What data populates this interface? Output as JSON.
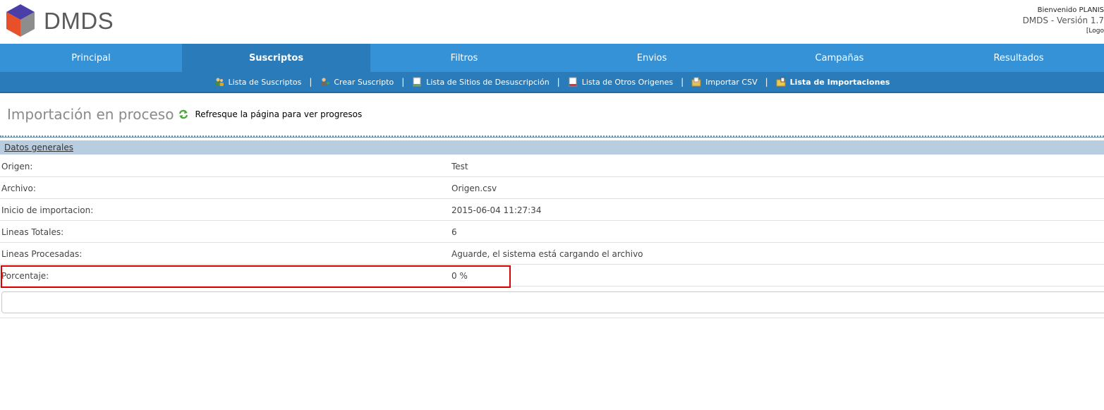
{
  "header": {
    "brand": "DMDS",
    "welcome": "Bienvenido PLANIS",
    "version": "DMDS - Versión 1.7",
    "logout": "[Logo"
  },
  "mainnav": {
    "items": [
      {
        "label": "Principal"
      },
      {
        "label": "Suscriptos",
        "active": true
      },
      {
        "label": "Filtros"
      },
      {
        "label": "Envios"
      },
      {
        "label": "Campañas"
      },
      {
        "label": "Resultados"
      }
    ]
  },
  "subnav": {
    "items": [
      {
        "label": "Lista de Suscriptos",
        "icon": "users-icon"
      },
      {
        "label": "Crear Suscripto",
        "icon": "user-add-icon"
      },
      {
        "label": "Lista de Sitios de Desuscripción",
        "icon": "document-icon"
      },
      {
        "label": "Lista de Otros Origenes",
        "icon": "document-red-icon"
      },
      {
        "label": "Importar CSV",
        "icon": "folder-import-icon"
      },
      {
        "label": "Lista de Importaciones",
        "icon": "folder-list-icon",
        "active": true
      }
    ],
    "separator": "|"
  },
  "page": {
    "title": "Importación en proceso",
    "refresh_icon": "refresh-icon",
    "refresh_text": "Refresque la página para ver progresos"
  },
  "section": {
    "title": "Datos generales",
    "rows": [
      {
        "key": "Origen:",
        "value": "Test"
      },
      {
        "key": "Archivo:",
        "value": "Origen.csv"
      },
      {
        "key": "Inicio de importacion:",
        "value": "2015-06-04 11:27:34"
      },
      {
        "key": "Lineas Totales:",
        "value": "6"
      },
      {
        "key": "Lineas Procesadas:",
        "value": "Aguarde, el sistema está cargando el archivo"
      },
      {
        "key": "Porcentaje:",
        "value": "0 %"
      }
    ]
  },
  "progress": {
    "value": 0
  },
  "colors": {
    "nav": "#3592d6",
    "nav_active": "#2a7bb9",
    "section_head": "#b8cde0",
    "highlight": "#e00000"
  }
}
